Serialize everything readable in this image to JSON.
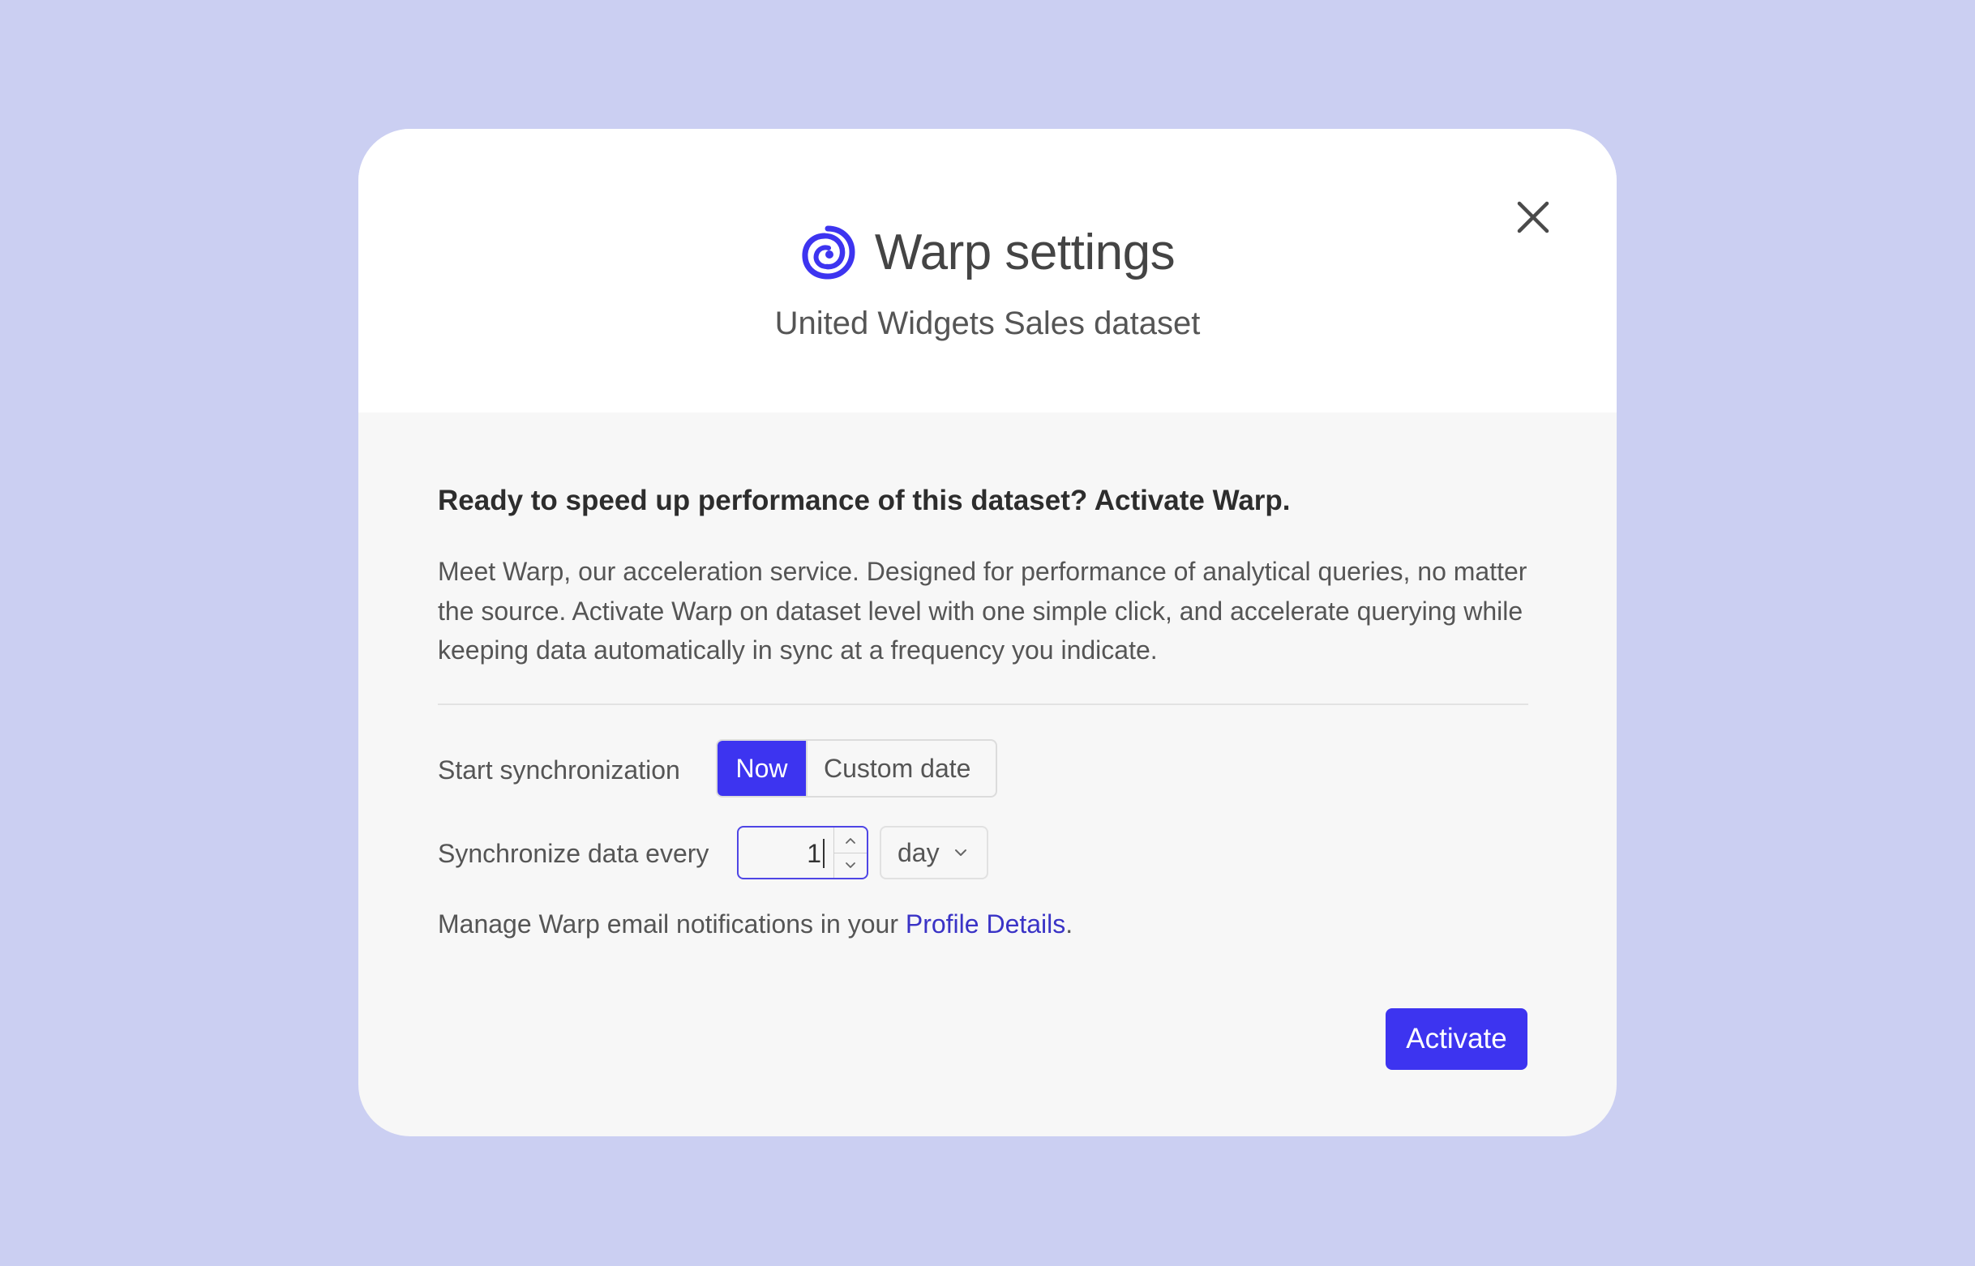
{
  "dialog": {
    "title": "Warp settings",
    "subtitle": "United Widgets Sales dataset",
    "close_icon": "close-icon",
    "logo_icon": "warp-swirl-icon",
    "accent_color": "#3d34f0",
    "link_color": "#3a33c6"
  },
  "intro": {
    "heading": "Ready to speed up performance of this dataset? Activate Warp.",
    "description": "Meet Warp, our acceleration service. Designed for performance of analytical queries, no matter the source. Activate Warp on dataset level with one simple click, and accelerate querying while keeping data automatically in sync at a frequency you indicate."
  },
  "sync_start": {
    "label": "Start synchronization",
    "options": [
      "Now",
      "Custom date"
    ],
    "selected": "Now"
  },
  "sync_frequency": {
    "label": "Synchronize data every",
    "value": "1",
    "unit": "day",
    "stepper_up_icon": "chevron-up-icon",
    "stepper_down_icon": "chevron-down-icon"
  },
  "notifications": {
    "text_before": "Manage Warp email notifications in your ",
    "link_text": "Profile Details",
    "text_after": "."
  },
  "footer": {
    "activate_label": "Activate"
  }
}
